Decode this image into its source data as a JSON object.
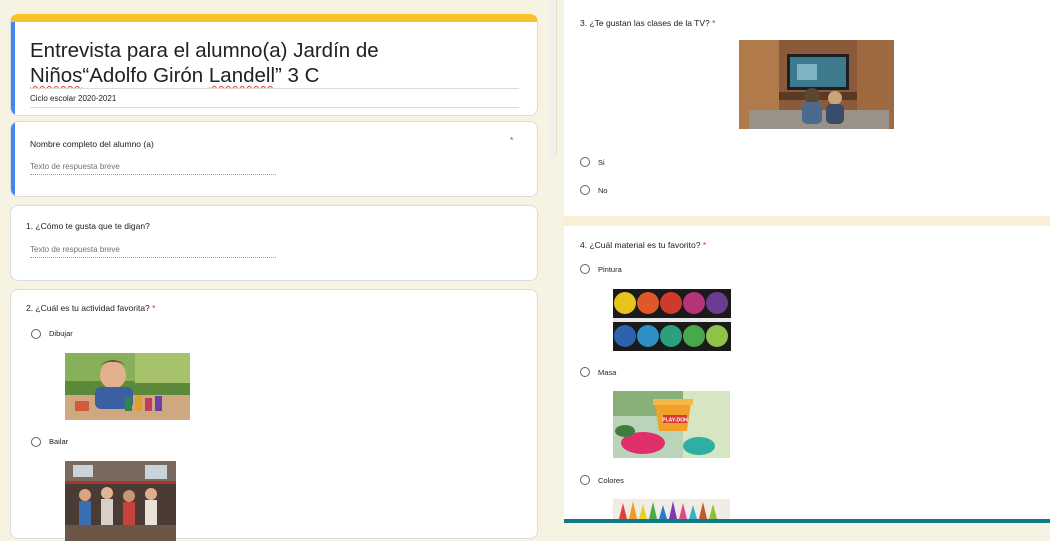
{
  "form": {
    "title_line1": "Entrevista para el alumno(a) Jardín de",
    "title_line2_a": "Niños",
    "title_line2_b": "“Adolfo Girón ",
    "title_line2_c": "Landell",
    "title_line2_d": "” 3 C",
    "description": "Ciclo escolar 2020-2021"
  },
  "colors": {
    "accent_yellow": "#f9c12c",
    "accent_blue": "#4285f4",
    "required_red": "#d93025",
    "background": "#f6f3e3",
    "bottom_bar": "#0e7a84"
  },
  "questions": {
    "q_name": {
      "label": "Nombre completo del alumno (a)",
      "required": "*",
      "placeholder": "Texto de respuesta breve"
    },
    "q1": {
      "label": "1.   ¿Cómo te gusta que te digan?",
      "placeholder": "Texto de respuesta breve"
    },
    "q2": {
      "label": "2.   ¿Cuál es tu actividad favorita?",
      "required": "*",
      "options": [
        "Dibujar",
        "Bailar"
      ]
    },
    "q3": {
      "label": "3.   ¿Te gustan las clases de la TV?",
      "required": "*",
      "options": [
        "Si",
        "No"
      ]
    },
    "q4": {
      "label": "4.   ¿Cuál material es tu favorito?",
      "required": "*",
      "options": [
        "Pintura",
        "Masa",
        "Colores"
      ]
    }
  },
  "images": {
    "q2_opt1": "photo of child drawing",
    "q2_opt2": "photo of children dancing",
    "q3": "photo of children watching TV",
    "q4_opt1": "photo of paint palette",
    "q4_opt2": "photo of play dough",
    "q4_opt3": "photo of crayons",
    "play_doh_logo_text": "PLAY-DOH"
  }
}
